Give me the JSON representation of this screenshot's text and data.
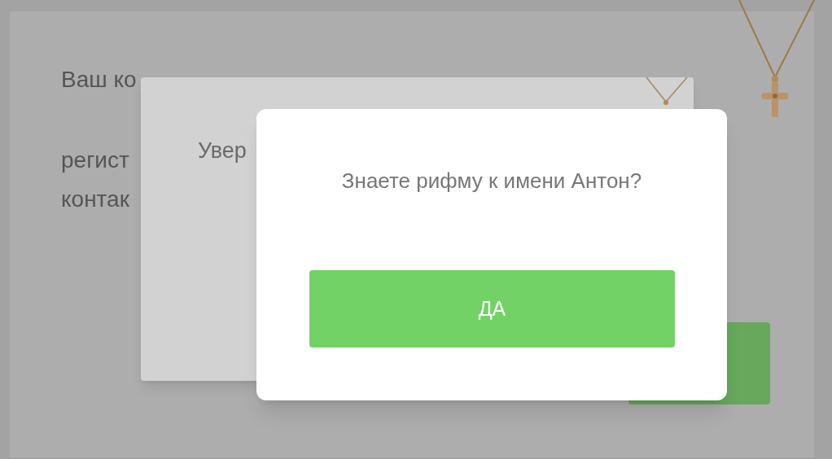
{
  "back_dialog": {
    "text_lines": [
      "Ваш ко",
      "регист",
      "контак"
    ]
  },
  "middle_dialog": {
    "text": "Увер"
  },
  "front_dialog": {
    "question": "Знаете рифму к имени Антон?",
    "button": "ДА"
  }
}
